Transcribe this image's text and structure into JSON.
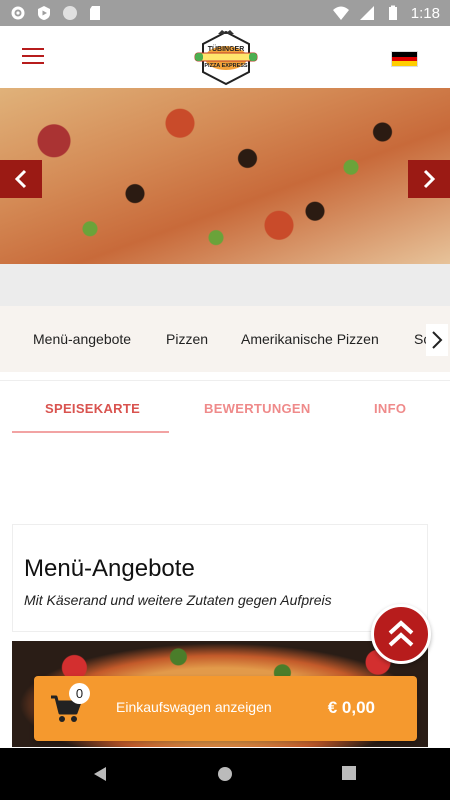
{
  "status_bar": {
    "time": "1:18",
    "icons": [
      "settings-icon",
      "play-protect-icon",
      "circle-icon",
      "sd-card-icon",
      "wifi-icon",
      "signal-icon",
      "battery-icon"
    ]
  },
  "header": {
    "logo_text_line1": "TÜBINGER",
    "logo_text_line2": "PIZZA EXPRESS",
    "language_flag": "de"
  },
  "categories": [
    {
      "label": "Menü-angebote"
    },
    {
      "label": "Pizzen"
    },
    {
      "label": "Amerikanische Pizzen"
    },
    {
      "label": "Sc"
    }
  ],
  "tabs": [
    {
      "label": "SPEISEKARTE",
      "active": true
    },
    {
      "label": "BEWERTUNGEN",
      "active": false
    },
    {
      "label": "INFO",
      "active": false
    }
  ],
  "menu_section": {
    "title": "Menü-Angebote",
    "subtitle": "Mit Käserand und weitere Zutaten gegen Aufpreis"
  },
  "cart": {
    "count": "0",
    "label": "Einkaufswagen anzeigen",
    "total": "€ 0,00"
  },
  "colors": {
    "accent_red": "#b71c1c",
    "cart_orange": "#f5992e",
    "tab_active": "#d9534f"
  }
}
